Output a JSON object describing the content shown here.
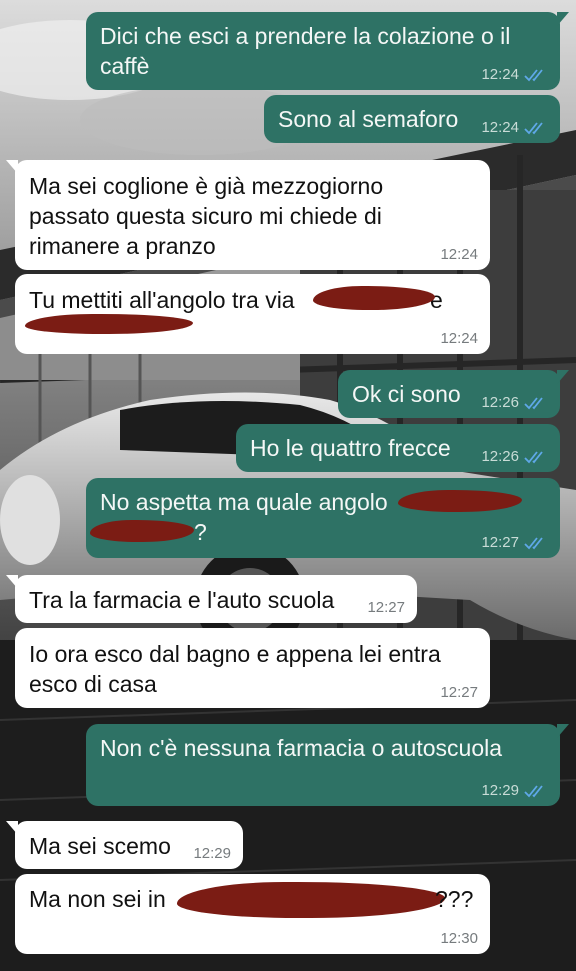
{
  "colors": {
    "outgoing_bubble": "#2e7265",
    "incoming_bubble": "#ffffff",
    "read_ticks": "#5fa8e8",
    "redaction": "#7b1c14"
  },
  "background": {
    "description_icon": "car-wallpaper-image"
  },
  "messages": [
    {
      "direction": "out",
      "text": "Dici che esci a prendere la colazione o il\ncaffè",
      "time": "12:24",
      "status": "read"
    },
    {
      "direction": "out",
      "text": "Sono al semaforo",
      "time": "12:24",
      "status": "read"
    },
    {
      "direction": "in",
      "text": "Ma sei coglione è già mezzogiorno\npassato questa sicuro mi chiede di\nrimanere a pranzo",
      "time": "12:24"
    },
    {
      "direction": "in",
      "text": "Tu mettiti all'angolo tra via",
      "text_after": "e",
      "time": "12:24",
      "redacted": true
    },
    {
      "direction": "out",
      "text": "Ok ci sono",
      "time": "12:26",
      "status": "read"
    },
    {
      "direction": "out",
      "text": "Ho le quattro frecce",
      "time": "12:26",
      "status": "read"
    },
    {
      "direction": "out",
      "text": "No aspetta ma quale angolo",
      "text_after": "?",
      "time": "12:27",
      "status": "read",
      "redacted": true
    },
    {
      "direction": "in",
      "text": "Tra la farmacia e l'auto scuola",
      "time": "12:27"
    },
    {
      "direction": "in",
      "text": "Io ora esco dal bagno e appena lei entra\nesco di casa",
      "time": "12:27"
    },
    {
      "direction": "out",
      "text": "Non c'è nessuna farmacia o autoscuola",
      "time": "12:29",
      "status": "read"
    },
    {
      "direction": "in",
      "text": "Ma sei scemo",
      "time": "12:29"
    },
    {
      "direction": "in",
      "text": "Ma non sei in",
      "text_after": "???",
      "time": "12:30",
      "redacted": true
    }
  ]
}
